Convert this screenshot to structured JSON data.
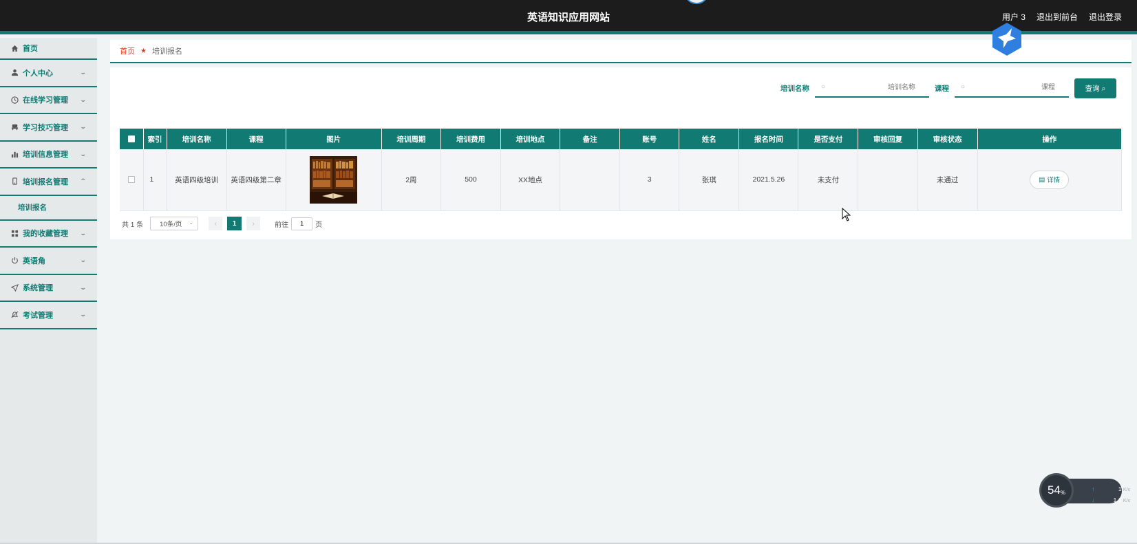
{
  "header": {
    "site_title": "英语知识应用网站",
    "user": "用户 3",
    "back_to_front": "退出到前台",
    "logout": "退出登录"
  },
  "sidebar": {
    "items": [
      {
        "label": "首页",
        "icon": "home-icon"
      },
      {
        "label": "个人中心",
        "icon": "user-icon"
      },
      {
        "label": "在线学习管理",
        "icon": "clock-icon"
      },
      {
        "label": "学习技巧管理",
        "icon": "chair-icon"
      },
      {
        "label": "培训信息管理",
        "icon": "bar-chart-icon"
      },
      {
        "label": "培训报名管理",
        "icon": "phone-icon"
      },
      {
        "label": "我的收藏管理",
        "icon": "grid-icon"
      },
      {
        "label": "英语角",
        "icon": "power-icon"
      },
      {
        "label": "系统管理",
        "icon": "send-icon"
      },
      {
        "label": "考试管理",
        "icon": "bell-icon"
      }
    ],
    "submenu_label": "培训报名"
  },
  "breadcrumb": {
    "home": "首页",
    "current": "培训报名"
  },
  "search": {
    "name_label": "培训名称",
    "name_placeholder": "培训名称",
    "course_label": "课程",
    "course_placeholder": "课程",
    "query_label": "查询"
  },
  "table": {
    "headers": [
      "索引",
      "培训名称",
      "课程",
      "图片",
      "培训周期",
      "培训费用",
      "培训地点",
      "备注",
      "账号",
      "姓名",
      "报名时间",
      "是否支付",
      "审核回复",
      "审核状态",
      "操作"
    ],
    "rows": [
      {
        "index": "1",
        "name": "英语四级培训",
        "course": "英语四级第二章",
        "period": "2周",
        "fee": "500",
        "location": "XX地点",
        "remark": "",
        "account": "3",
        "person": "张琪",
        "time": "2021.5.26",
        "paid": "未支付",
        "reply": "",
        "status": "未通过",
        "action": "详情"
      }
    ]
  },
  "pagination": {
    "total": "共 1 条",
    "page_size": "10条/页",
    "current_page": "1",
    "goto_label": "前往",
    "goto_value": "1",
    "page_suffix": "页"
  },
  "net_widget": {
    "percent": "54",
    "percent_unit": "%",
    "up": "1",
    "down": "1.1",
    "unit": "K/s"
  },
  "colors": {
    "accent": "#107a73",
    "header_bg": "#1c1c1c",
    "breadcrumb_home": "#d9432f"
  }
}
